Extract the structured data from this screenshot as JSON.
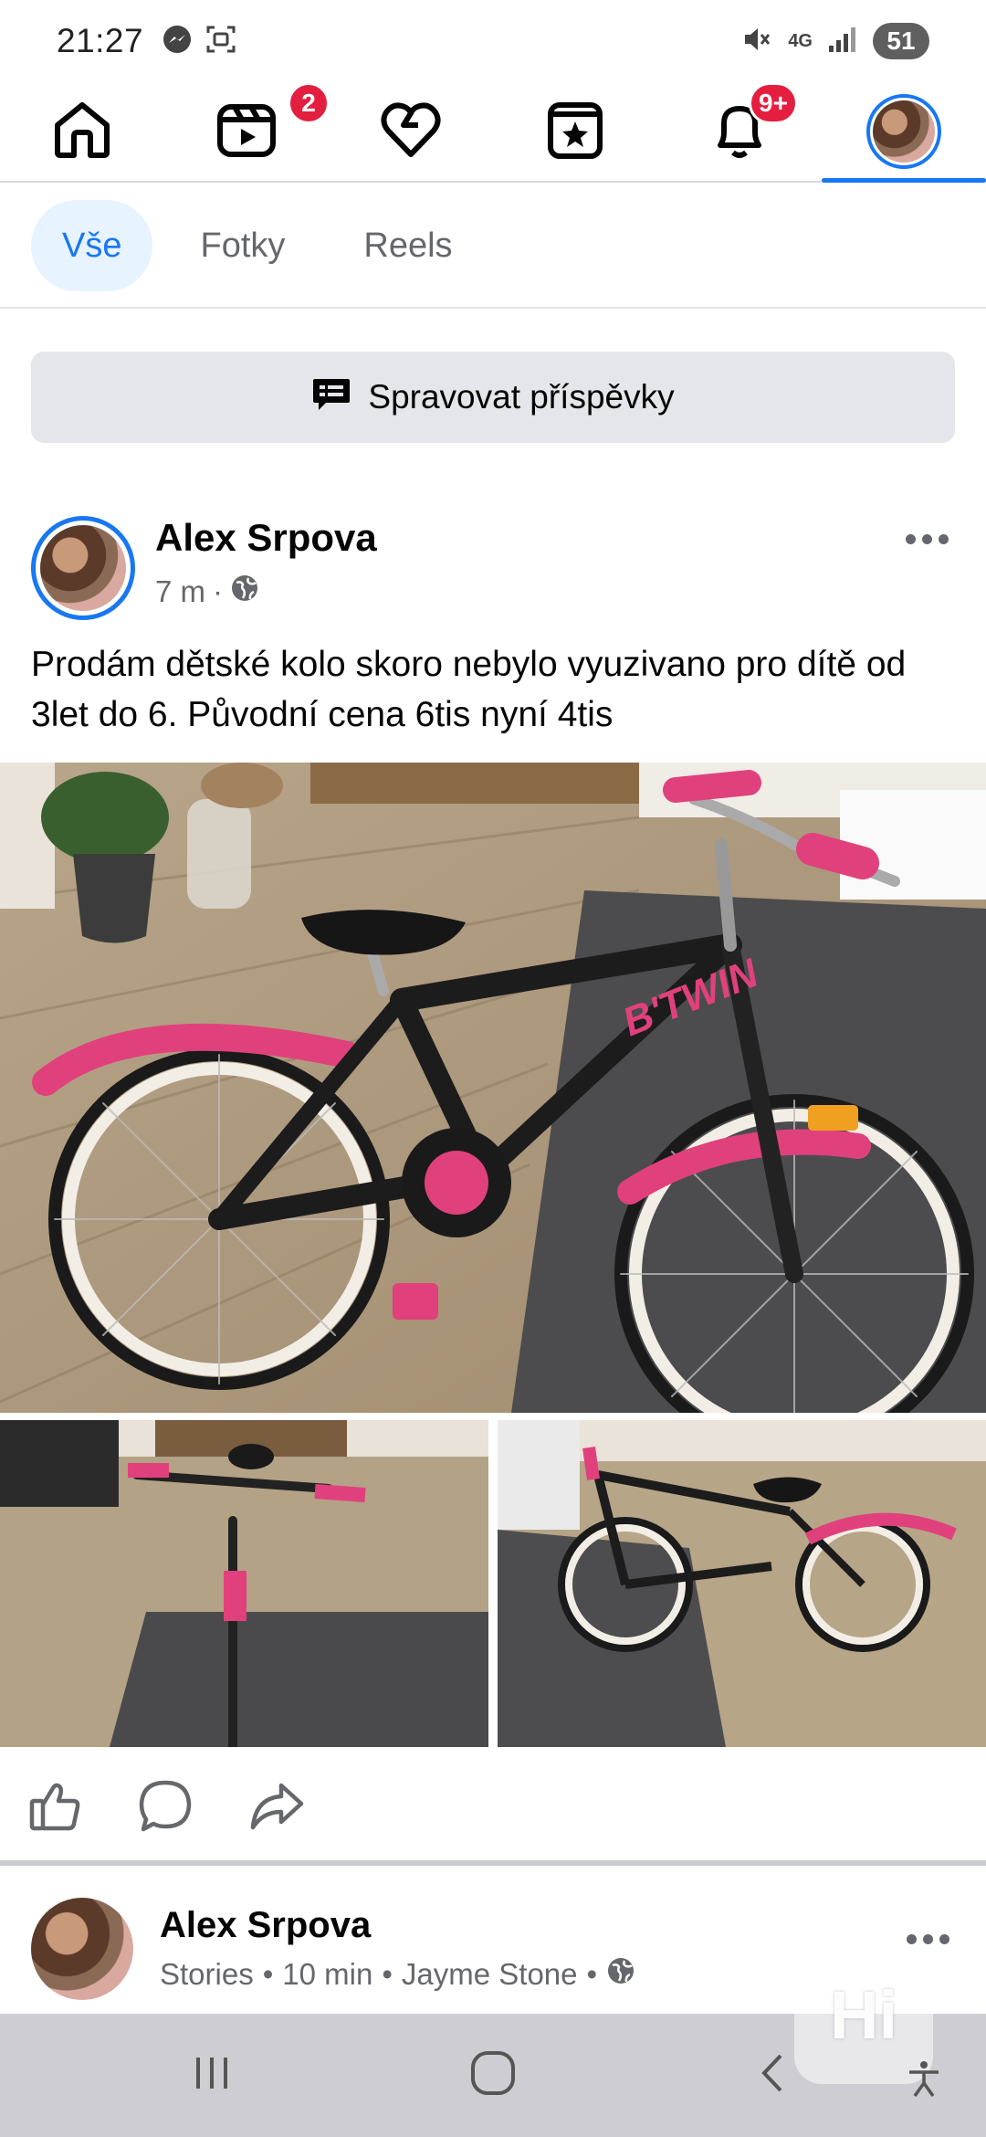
{
  "status_bar": {
    "time": "21:27",
    "network": "4G",
    "battery": "51",
    "icons": [
      "messenger-icon",
      "screenshot-icon",
      "mute-icon",
      "signal-icon"
    ]
  },
  "top_nav": {
    "items": [
      {
        "name": "home",
        "icon": "home-icon",
        "badge": ""
      },
      {
        "name": "video",
        "icon": "video-icon",
        "badge": "2"
      },
      {
        "name": "dating",
        "icon": "heart-icon",
        "badge": ""
      },
      {
        "name": "marketplace",
        "icon": "star-page-icon",
        "badge": ""
      },
      {
        "name": "notifications",
        "icon": "bell-icon",
        "badge": "9+"
      },
      {
        "name": "profile",
        "icon": "avatar",
        "badge": ""
      }
    ],
    "active_index": 5
  },
  "filter_tabs": {
    "tabs": [
      "Vše",
      "Fotky",
      "Reels"
    ],
    "active_index": 0
  },
  "manage_posts": {
    "label": "Spravovat příspěvky",
    "icon": "manage-posts-icon"
  },
  "post": {
    "author": "Alex Srpova",
    "time": "7 m",
    "separator": "·",
    "privacy_icon": "globe-icon",
    "text": "Prodám dětské kolo skoro nebylo vyuzivano pro dítě od 3let do 6. Původní cena 6tis nyní 4tis",
    "bike_brand": "B'TWIN",
    "actions": [
      "like-icon",
      "comment-icon",
      "share-icon"
    ]
  },
  "post2": {
    "author": "Alex Srpova",
    "source": "Stories",
    "time": "10 min",
    "tagged": "Jayme Stone",
    "bullet": "•",
    "privacy_icon": "globe-icon"
  },
  "watermark": "Hi",
  "colors": {
    "accent": "#1877f2",
    "badge": "#e41e3f",
    "secondary_text": "#65676b",
    "tab_active_bg": "#e7f3ff",
    "button_bg": "#e4e6eb"
  }
}
